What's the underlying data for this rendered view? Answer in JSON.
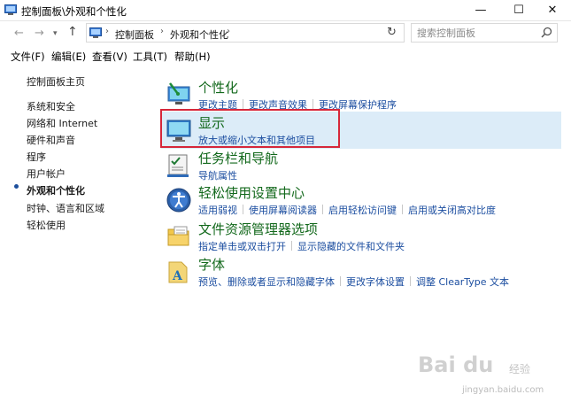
{
  "window": {
    "title": "控制面板\\外观和个性化",
    "minimize": "—",
    "maximize": "☐",
    "close": "✕"
  },
  "address": {
    "crumbs": [
      "控制面板",
      "外观和个性化"
    ],
    "separator": "›",
    "search_placeholder": "搜索控制面板"
  },
  "menu": [
    "文件(F)",
    "编辑(E)",
    "查看(V)",
    "工具(T)",
    "帮助(H)"
  ],
  "sidebar": {
    "home": "控制面板主页",
    "items": [
      {
        "label": "系统和安全"
      },
      {
        "label": "网络和 Internet"
      },
      {
        "label": "硬件和声音"
      },
      {
        "label": "程序"
      },
      {
        "label": "用户帐户"
      },
      {
        "label": "外观和个性化",
        "current": true
      },
      {
        "label": "时钟、语言和区域"
      },
      {
        "label": "轻松使用"
      }
    ]
  },
  "categories": [
    {
      "title": "个性化",
      "icon": "personalization-icon",
      "links": [
        "更改主题",
        "更改声音效果",
        "更改屏幕保护程序"
      ]
    },
    {
      "title": "显示",
      "icon": "display-icon",
      "links": [
        "放大或缩小文本和其他项目"
      ],
      "highlighted": true
    },
    {
      "title": "任务栏和导航",
      "icon": "taskbar-icon",
      "links": [
        "导航属性"
      ]
    },
    {
      "title": "轻松使用设置中心",
      "icon": "ease-of-access-icon",
      "links": [
        "适用弱视",
        "使用屏幕阅读器",
        "启用轻松访问键",
        "启用或关闭高对比度"
      ]
    },
    {
      "title": "文件资源管理器选项",
      "icon": "folder-options-icon",
      "links": [
        "指定单击或双击打开",
        "显示隐藏的文件和文件夹"
      ]
    },
    {
      "title": "字体",
      "icon": "fonts-icon",
      "links": [
        "预览、删除或者显示和隐藏字体",
        "更改字体设置",
        "调整 ClearType 文本"
      ]
    }
  ],
  "watermark": {
    "brand": "Bai du",
    "cn": "经验",
    "url": "jingyan.baidu.com"
  },
  "colors": {
    "category_title": "#13691c",
    "link": "#1c4ea0",
    "highlight_bg": "#dcecf8",
    "annotation_box": "#d6273a"
  }
}
